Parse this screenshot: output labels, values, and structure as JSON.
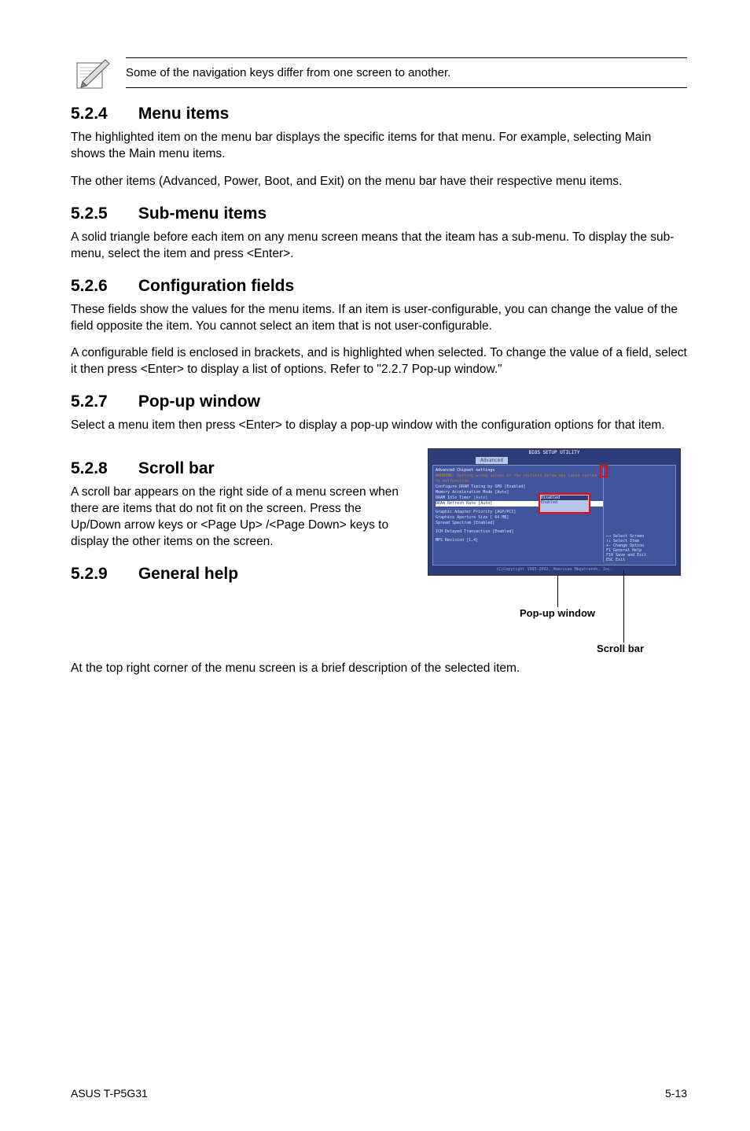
{
  "note": {
    "text": "Some of the navigation keys differ from one screen to another."
  },
  "sections": {
    "s524": {
      "num": "5.2.4",
      "title": "Menu items"
    },
    "s524_p1": "The highlighted item on the menu bar  displays the specific items for that menu. For example, selecting Main shows the Main menu items.",
    "s524_p2": "The other items (Advanced, Power, Boot, and Exit) on the menu bar have their respective menu items.",
    "s525": {
      "num": "5.2.5",
      "title": "Sub-menu items"
    },
    "s525_p1": "A solid triangle before each item on any menu screen means that the iteam has a sub-menu. To display the sub-menu, select the item and press <Enter>.",
    "s526": {
      "num": "5.2.6",
      "title": "Configuration fields"
    },
    "s526_p1": "These fields show the values for the menu items. If an item is user-configurable, you can change the value of the field opposite the item. You cannot select an item that is not user-configurable.",
    "s526_p2": "A configurable field is enclosed in brackets, and is highlighted when selected. To change the value of a field, select it then press <Enter> to display a list of options. Refer to \"2.2.7 Pop-up window.\"",
    "s527": {
      "num": "5.2.7",
      "title": "Pop-up window"
    },
    "s527_p1": "Select a menu item then press <Enter> to display a pop-up window with the configuration options for that item.",
    "s528": {
      "num": "5.2.8",
      "title": "Scroll bar"
    },
    "s528_p1": "A scroll bar appears on the right side of a menu screen when there are items that do not fit on the screen. Press the",
    "s528_p2": "Up/Down arrow keys or <Page Up> /<Page Down> keys to display the other items on the screen.",
    "s529": {
      "num": "5.2.9",
      "title": "General help"
    },
    "s529_p1": "At the top right corner of the menu screen is a brief description of the selected item."
  },
  "bios": {
    "title": "BIOS SETUP UTILITY",
    "tab": "Advanced",
    "heading": "Advanced Chipset settings",
    "warning": "WARNING: Setting wrong values in the sections below may cause system to malfunction.",
    "rows": {
      "r1": "Configure DRAM Timing by SPD",
      "r1v": "[Enabled]",
      "r2": "Memory Acceleration Mode",
      "r2v": "[Auto]",
      "r3": "DRAM Idle Timer",
      "r3v": "[Auto]",
      "r4": "DRAm Refresh Rate",
      "r4v": "[Auto]",
      "r5": "Graphic Adapter Priority",
      "r5v": "[AGP/PCI]",
      "r6": "Graphics Aperture Size",
      "r6v": "[ 64 MB]",
      "r7": "Spread Spectrum",
      "r7v": "[Enabled]",
      "r8": "ICH Delayed Transaction",
      "r8v": "[Enabled]",
      "r9": "MPS Revision",
      "r9v": "[1.4]"
    },
    "popup": {
      "opt1": "Disabled",
      "opt2": "Enabled"
    },
    "help": {
      "h1": "Select Screen",
      "h2": "Select Item",
      "h3": "Change Option",
      "h4": "General Help",
      "h5": "Save and Exit",
      "h6": "Exit",
      "k3": "+-",
      "k4": "F1",
      "k5": "F10",
      "k6": "ESC"
    },
    "copyright": "(C)Copyright 1985-2002, American Megatrends, Inc."
  },
  "callouts": {
    "popup": "Pop-up window",
    "scrollbar": "Scroll bar"
  },
  "footer": {
    "left": "ASUS T-P5G31",
    "right": "5-13"
  }
}
